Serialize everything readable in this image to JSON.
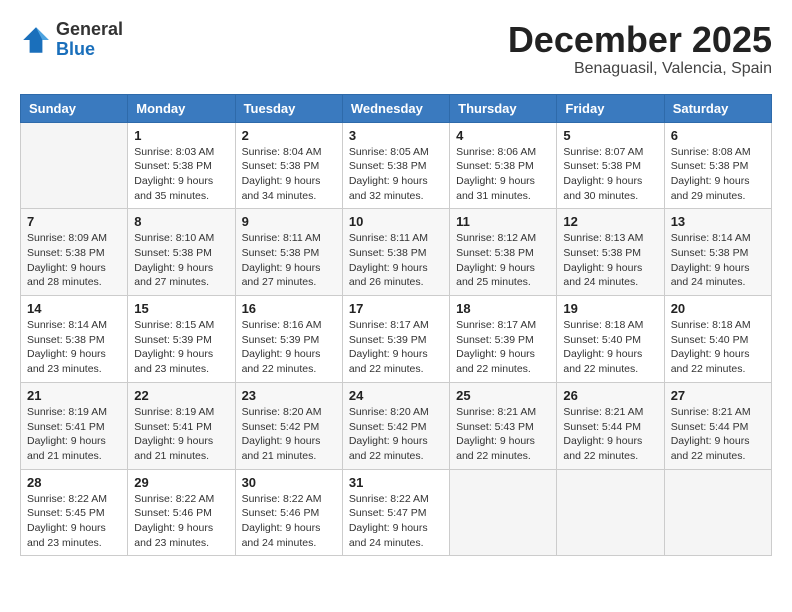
{
  "header": {
    "logo_general": "General",
    "logo_blue": "Blue",
    "month_title": "December 2025",
    "subtitle": "Benaguasil, Valencia, Spain"
  },
  "weekdays": [
    "Sunday",
    "Monday",
    "Tuesday",
    "Wednesday",
    "Thursday",
    "Friday",
    "Saturday"
  ],
  "weeks": [
    [
      {
        "day": "",
        "info": ""
      },
      {
        "day": "1",
        "info": "Sunrise: 8:03 AM\nSunset: 5:38 PM\nDaylight: 9 hours\nand 35 minutes."
      },
      {
        "day": "2",
        "info": "Sunrise: 8:04 AM\nSunset: 5:38 PM\nDaylight: 9 hours\nand 34 minutes."
      },
      {
        "day": "3",
        "info": "Sunrise: 8:05 AM\nSunset: 5:38 PM\nDaylight: 9 hours\nand 32 minutes."
      },
      {
        "day": "4",
        "info": "Sunrise: 8:06 AM\nSunset: 5:38 PM\nDaylight: 9 hours\nand 31 minutes."
      },
      {
        "day": "5",
        "info": "Sunrise: 8:07 AM\nSunset: 5:38 PM\nDaylight: 9 hours\nand 30 minutes."
      },
      {
        "day": "6",
        "info": "Sunrise: 8:08 AM\nSunset: 5:38 PM\nDaylight: 9 hours\nand 29 minutes."
      }
    ],
    [
      {
        "day": "7",
        "info": "Sunrise: 8:09 AM\nSunset: 5:38 PM\nDaylight: 9 hours\nand 28 minutes."
      },
      {
        "day": "8",
        "info": "Sunrise: 8:10 AM\nSunset: 5:38 PM\nDaylight: 9 hours\nand 27 minutes."
      },
      {
        "day": "9",
        "info": "Sunrise: 8:11 AM\nSunset: 5:38 PM\nDaylight: 9 hours\nand 27 minutes."
      },
      {
        "day": "10",
        "info": "Sunrise: 8:11 AM\nSunset: 5:38 PM\nDaylight: 9 hours\nand 26 minutes."
      },
      {
        "day": "11",
        "info": "Sunrise: 8:12 AM\nSunset: 5:38 PM\nDaylight: 9 hours\nand 25 minutes."
      },
      {
        "day": "12",
        "info": "Sunrise: 8:13 AM\nSunset: 5:38 PM\nDaylight: 9 hours\nand 24 minutes."
      },
      {
        "day": "13",
        "info": "Sunrise: 8:14 AM\nSunset: 5:38 PM\nDaylight: 9 hours\nand 24 minutes."
      }
    ],
    [
      {
        "day": "14",
        "info": "Sunrise: 8:14 AM\nSunset: 5:38 PM\nDaylight: 9 hours\nand 23 minutes."
      },
      {
        "day": "15",
        "info": "Sunrise: 8:15 AM\nSunset: 5:39 PM\nDaylight: 9 hours\nand 23 minutes."
      },
      {
        "day": "16",
        "info": "Sunrise: 8:16 AM\nSunset: 5:39 PM\nDaylight: 9 hours\nand 22 minutes."
      },
      {
        "day": "17",
        "info": "Sunrise: 8:17 AM\nSunset: 5:39 PM\nDaylight: 9 hours\nand 22 minutes."
      },
      {
        "day": "18",
        "info": "Sunrise: 8:17 AM\nSunset: 5:39 PM\nDaylight: 9 hours\nand 22 minutes."
      },
      {
        "day": "19",
        "info": "Sunrise: 8:18 AM\nSunset: 5:40 PM\nDaylight: 9 hours\nand 22 minutes."
      },
      {
        "day": "20",
        "info": "Sunrise: 8:18 AM\nSunset: 5:40 PM\nDaylight: 9 hours\nand 22 minutes."
      }
    ],
    [
      {
        "day": "21",
        "info": "Sunrise: 8:19 AM\nSunset: 5:41 PM\nDaylight: 9 hours\nand 21 minutes."
      },
      {
        "day": "22",
        "info": "Sunrise: 8:19 AM\nSunset: 5:41 PM\nDaylight: 9 hours\nand 21 minutes."
      },
      {
        "day": "23",
        "info": "Sunrise: 8:20 AM\nSunset: 5:42 PM\nDaylight: 9 hours\nand 21 minutes."
      },
      {
        "day": "24",
        "info": "Sunrise: 8:20 AM\nSunset: 5:42 PM\nDaylight: 9 hours\nand 22 minutes."
      },
      {
        "day": "25",
        "info": "Sunrise: 8:21 AM\nSunset: 5:43 PM\nDaylight: 9 hours\nand 22 minutes."
      },
      {
        "day": "26",
        "info": "Sunrise: 8:21 AM\nSunset: 5:44 PM\nDaylight: 9 hours\nand 22 minutes."
      },
      {
        "day": "27",
        "info": "Sunrise: 8:21 AM\nSunset: 5:44 PM\nDaylight: 9 hours\nand 22 minutes."
      }
    ],
    [
      {
        "day": "28",
        "info": "Sunrise: 8:22 AM\nSunset: 5:45 PM\nDaylight: 9 hours\nand 23 minutes."
      },
      {
        "day": "29",
        "info": "Sunrise: 8:22 AM\nSunset: 5:46 PM\nDaylight: 9 hours\nand 23 minutes."
      },
      {
        "day": "30",
        "info": "Sunrise: 8:22 AM\nSunset: 5:46 PM\nDaylight: 9 hours\nand 24 minutes."
      },
      {
        "day": "31",
        "info": "Sunrise: 8:22 AM\nSunset: 5:47 PM\nDaylight: 9 hours\nand 24 minutes."
      },
      {
        "day": "",
        "info": ""
      },
      {
        "day": "",
        "info": ""
      },
      {
        "day": "",
        "info": ""
      }
    ]
  ]
}
